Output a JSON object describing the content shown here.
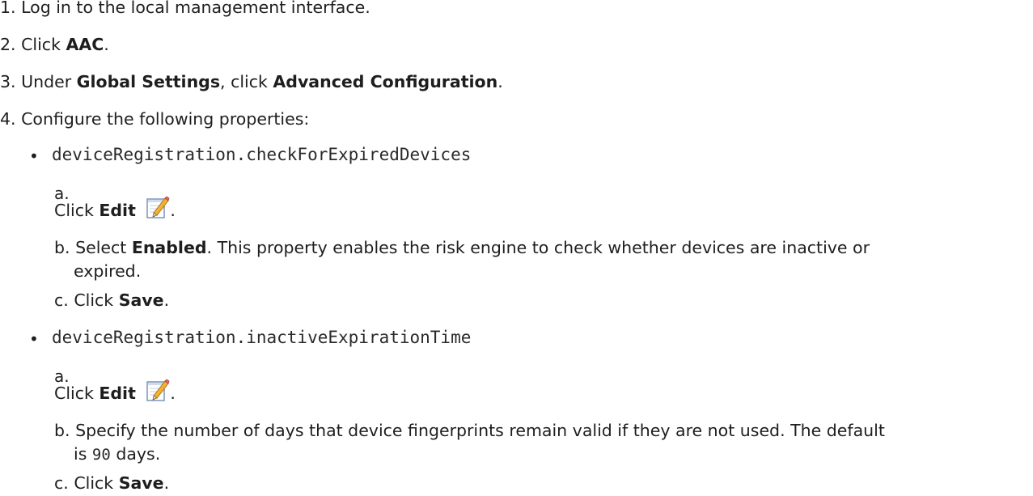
{
  "steps": [
    {
      "num": "1.",
      "text": "Log in to the local management interface."
    },
    {
      "num": "2.",
      "pre": "Click ",
      "bold": "AAC",
      "post": "."
    },
    {
      "num": "3.",
      "pre": "Under ",
      "bold1": "Global Settings",
      "mid": ", click ",
      "bold2": "Advanced Configuration",
      "post": "."
    },
    {
      "num": "4.",
      "text": "Configure the following properties:"
    }
  ],
  "properties": [
    {
      "bullet": "•",
      "name": "deviceRegistration.checkForExpiredDevices",
      "substeps": {
        "a": {
          "label": "a.",
          "pre": "Click ",
          "bold": "Edit",
          "post": ".",
          "icon": "edit-icon"
        },
        "b": {
          "label": "b.",
          "pre": "Select ",
          "bold": "Enabled",
          "post": ". This property enables the risk engine to check whether devices are inactive or",
          "cont": "expired."
        },
        "c": {
          "label": "c.",
          "pre": "Click ",
          "bold": "Save",
          "post": "."
        }
      }
    },
    {
      "bullet": "•",
      "name": "deviceRegistration.inactiveExpirationTime",
      "substeps": {
        "a": {
          "label": "a.",
          "pre": "Click ",
          "bold": "Edit",
          "post": ".",
          "icon": "edit-icon"
        },
        "b": {
          "label": "b.",
          "pre": "Specify the number of days that device fingerprints remain valid if they are not used. The default",
          "cont_pre": "is ",
          "cont_mono": "90",
          "cont_post": " days."
        },
        "c": {
          "label": "c.",
          "pre": "Click ",
          "bold": "Save",
          "post": "."
        }
      }
    }
  ]
}
